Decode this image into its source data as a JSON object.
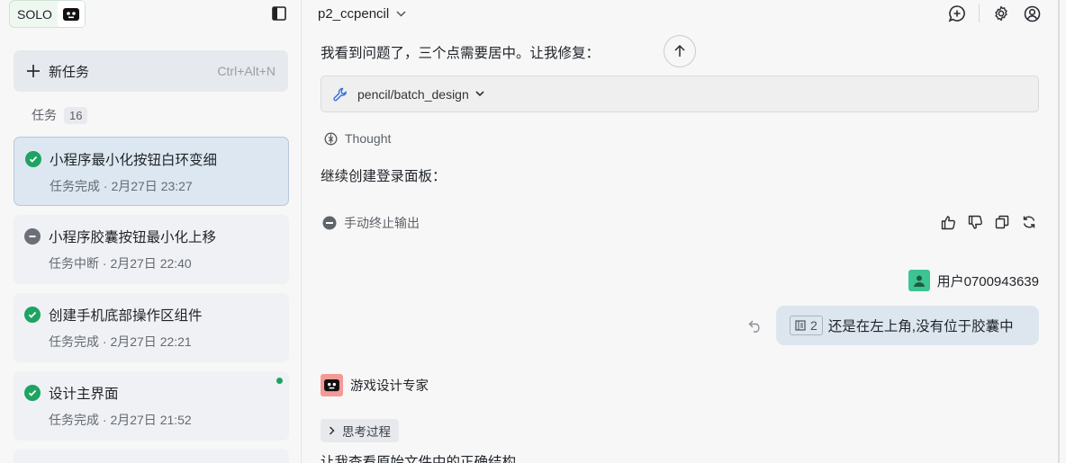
{
  "sidebar": {
    "brand": "SOLO",
    "new_task": {
      "label": "新任务",
      "shortcut": "Ctrl+Alt+N"
    },
    "tasks_header": {
      "title": "任务",
      "count": "16"
    },
    "tasks": [
      {
        "title": "小程序最小化按钮白环变细",
        "meta": "任务完成 · 2月27日 23:27",
        "status": "done"
      },
      {
        "title": "小程序胶囊按钮最小化上移",
        "meta": "任务中断 · 2月27日 22:40",
        "status": "stopped"
      },
      {
        "title": "创建手机底部操作区组件",
        "meta": "任务完成 · 2月27日 22:21",
        "status": "done"
      },
      {
        "title": "设计主界面",
        "meta": "任务完成 · 2月27日 21:52",
        "status": "done"
      }
    ]
  },
  "main": {
    "project_name": "p2_ccpencil",
    "messages": {
      "line1": "我看到问题了，三个点需要居中。让我修复：",
      "tool_call": "pencil/batch_design",
      "thought": "Thought",
      "line2": "继续创建登录面板：",
      "abort": "手动终止输出",
      "user_name": "用户0700943639",
      "user_chip_num": "2",
      "user_text": "还是在左上角,没有位于胶囊中",
      "agent_name": "游戏设计专家",
      "think_label": "思考过程",
      "cut_text": "让我查看原始文件中的正确结构"
    },
    "colors": {
      "success": "#1ea362",
      "user_avatar": "#3cc493",
      "agent_avatar": "#f39a95",
      "accent_blue": "#2f6fde"
    }
  }
}
